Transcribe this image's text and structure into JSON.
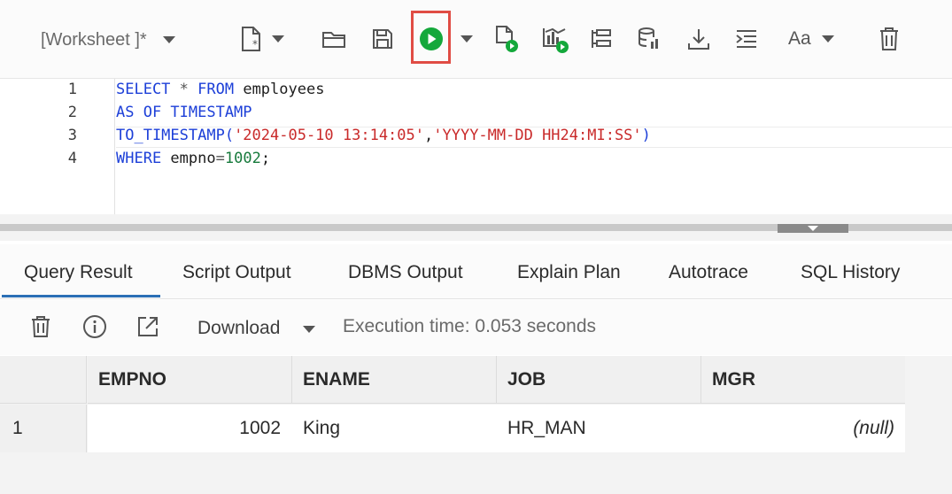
{
  "toolbar": {
    "worksheet_title": "[Worksheet ]*",
    "icons": [
      "new-file-icon",
      "open-folder-icon",
      "save-icon",
      "run-statement-icon",
      "run-script-icon",
      "autotrace-icon",
      "explain-plan-icon",
      "database-icon",
      "download-icon",
      "format-icon",
      "font-icon",
      "trash-icon"
    ],
    "font_label": "Aa",
    "run_color": "#14a83b",
    "highlight_color": "#e04c44"
  },
  "editor": {
    "line_numbers": [
      "1",
      "2",
      "3",
      "4"
    ],
    "lines": [
      [
        {
          "t": "kw",
          "v": "SELECT"
        },
        {
          "t": "op",
          "v": " * "
        },
        {
          "t": "kw",
          "v": "FROM"
        },
        {
          "t": "plain",
          "v": " employees"
        }
      ],
      [
        {
          "t": "kw",
          "v": "AS OF TIMESTAMP"
        }
      ],
      [
        {
          "t": "fn",
          "v": "TO_TIMESTAMP("
        },
        {
          "t": "str",
          "v": "'2024-05-10 13:14:05'"
        },
        {
          "t": "plain",
          "v": ","
        },
        {
          "t": "str",
          "v": "'YYYY-MM-DD HH24:MI:SS'"
        },
        {
          "t": "fn",
          "v": ")"
        }
      ],
      [
        {
          "t": "kw",
          "v": "WHERE"
        },
        {
          "t": "plain",
          "v": " empno"
        },
        {
          "t": "op",
          "v": "="
        },
        {
          "t": "num",
          "v": "1002"
        },
        {
          "t": "plain",
          "v": ";"
        }
      ]
    ]
  },
  "tabs": [
    {
      "label": "Query Result",
      "active": true
    },
    {
      "label": "Script Output",
      "active": false
    },
    {
      "label": "DBMS Output",
      "active": false
    },
    {
      "label": "Explain Plan",
      "active": false
    },
    {
      "label": "Autotrace",
      "active": false
    },
    {
      "label": "SQL History",
      "active": false
    }
  ],
  "result_toolbar": {
    "download_label": "Download",
    "execution_time": "Execution time: 0.053 seconds"
  },
  "grid": {
    "columns": [
      "EMPNO",
      "ENAME",
      "JOB",
      "MGR"
    ],
    "rows": [
      {
        "row_number": "1",
        "cells": [
          "1002",
          "King",
          "HR_MAN",
          "(null)"
        ]
      }
    ]
  }
}
